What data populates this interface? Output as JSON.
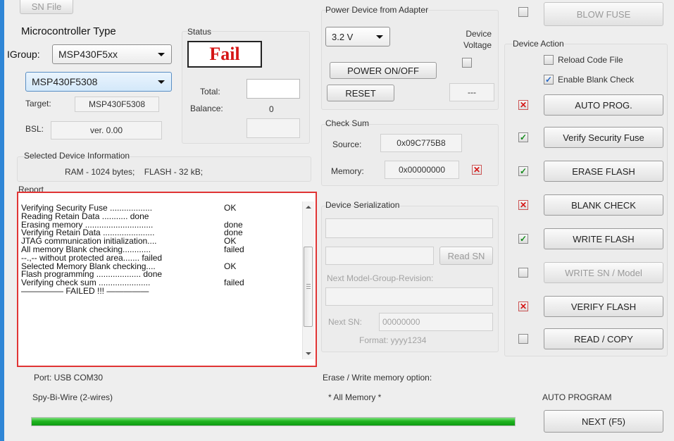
{
  "top": {
    "sn_file_label": "SN File",
    "blow_fuse_label": "BLOW FUSE"
  },
  "micro": {
    "title": "Microcontroller Type",
    "group_label": "IGroup:",
    "group_value": "MSP430F5xx",
    "device_value": "MSP430F5308",
    "target_label": "Target:",
    "target_value": "MSP430F5308",
    "bsl_label": "BSL:",
    "bsl_value": "ver. 0.00"
  },
  "status": {
    "title": "Status",
    "result": "Fail",
    "total_label": "Total:",
    "total_value": "",
    "balance_label": "Balance:",
    "balance_value": "0",
    "extra_value": ""
  },
  "selected_info": {
    "title": "Selected Device Information",
    "text": "RAM - 1024 bytes;    FLASH - 32 kB;"
  },
  "report": {
    "title": "Report",
    "lines": [
      {
        "text": "Verifying Security Fuse ..................",
        "status": "OK"
      },
      {
        "text": "Reading Retain Data ...........       done",
        "status": ""
      },
      {
        "text": "Erasing memory .............................",
        "status": "done"
      },
      {
        "text": "Verifying Retain Data ......................",
        "status": "done"
      },
      {
        "text": "JTAG communication initialization....",
        "status": "OK"
      },
      {
        "text": "All memory Blank checking............",
        "status": "failed"
      },
      {
        "text": "   --.,-- without protected area.......   failed",
        "status": ""
      },
      {
        "text": "Selected Memory Blank checking....",
        "status": "OK"
      },
      {
        "text": "Flash programming ...................     done",
        "status": ""
      },
      {
        "text": "Verifying check sum ......................",
        "status": "failed"
      },
      {
        "text": "————— FAILED !!! —————",
        "status": ""
      }
    ]
  },
  "power": {
    "title": "Power Device from Adapter",
    "voltage_value": "3.2 V",
    "device_voltage_label": "Device Voltage",
    "power_button": "POWER ON/OFF",
    "reset_button": "RESET",
    "voltage_readout": "---"
  },
  "checksum": {
    "title": "Check Sum",
    "source_label": "Source:",
    "source_value": "0x09C775B8",
    "memory_label": "Memory:",
    "memory_value": "0x00000000"
  },
  "serial": {
    "title": "Device Serialization",
    "read_sn_button": "Read SN",
    "next_model_label": "Next Model-Group-Revision:",
    "next_sn_label": "Next SN:",
    "next_sn_value": "00000000",
    "format_label": "Format: yyyy1234"
  },
  "device_action": {
    "title": "Device Action",
    "reload_label": "Reload Code File",
    "blank_check_label": "Enable Blank Check",
    "actions": [
      {
        "label": "AUTO PROG.",
        "mark": "✕",
        "state": "red"
      },
      {
        "label": "Verify Security Fuse",
        "mark": "✓",
        "state": "green"
      },
      {
        "label": "ERASE FLASH",
        "mark": "✓",
        "state": "green"
      },
      {
        "label": "BLANK CHECK",
        "mark": "✕",
        "state": "red"
      },
      {
        "label": "WRITE FLASH",
        "mark": "✓",
        "state": "green"
      },
      {
        "label": "WRITE SN / Model",
        "mark": "",
        "state": "off"
      },
      {
        "label": "VERIFY FLASH",
        "mark": "✕",
        "state": "red"
      },
      {
        "label": "READ / COPY",
        "mark": "",
        "state": "off"
      }
    ]
  },
  "footer": {
    "port_label": "Port: USB COM30",
    "interface_label": "Spy-Bi-Wire (2-wires)",
    "erase_option_label": "Erase / Write memory option:",
    "erase_option_value": "* All Memory *",
    "auto_program_label": "AUTO PROGRAM",
    "next_button": "NEXT  (F5)",
    "progress": 1.0
  },
  "colors": {
    "accent": "#2f86d6",
    "fail_red": "#d51515",
    "ok_green": "#138a1b",
    "progress_green": "#1fb520"
  }
}
